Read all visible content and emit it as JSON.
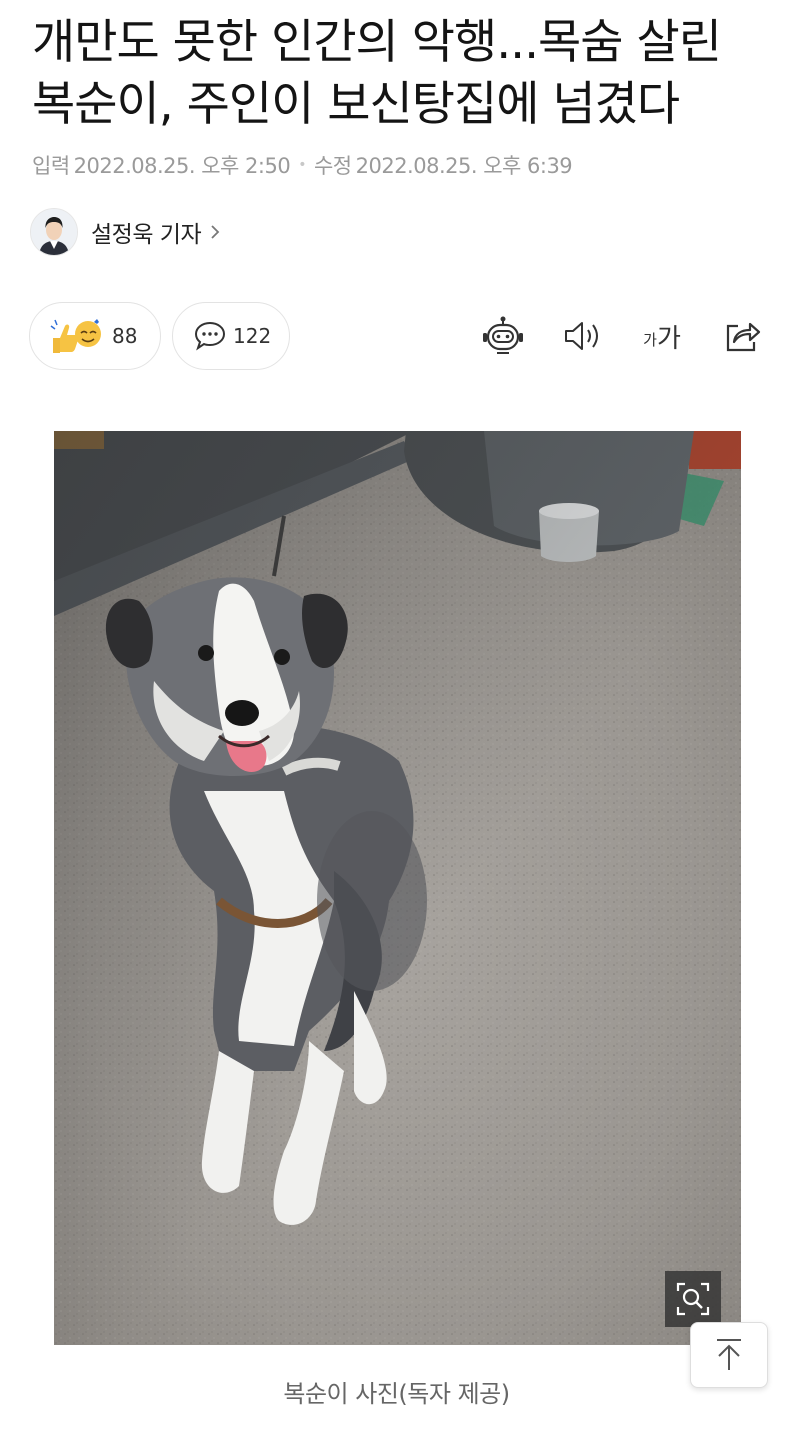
{
  "article": {
    "title": "개만도 못한 인간의 악행...목숨 살린 복순이, 주인이 보신탕집에 넘겼다",
    "published_label": "입력",
    "published": "2022.08.25. 오후 2:50",
    "modified_label": "수정",
    "modified": "2022.08.25. 오후 6:39",
    "reporter": "설정욱 기자"
  },
  "reactions": {
    "count": "88",
    "icons": [
      "thumbs-up-icon",
      "smiling-face-icon"
    ]
  },
  "comments": {
    "count": "122",
    "icon": "speech-bubble-icon"
  },
  "toolbar": {
    "summary_icon": "robot-icon",
    "tts_icon": "speaker-icon",
    "font_size": {
      "small": "가",
      "large": "가"
    },
    "share_icon": "share-icon"
  },
  "photo": {
    "caption": "복순이 사진(독자 제공)",
    "zoom_icon": "zoom-magnifier-icon"
  },
  "scroll_top_icon": "arrow-up-icon",
  "colors": {
    "meta_text": "#9a9a9a",
    "caption_text": "#666666",
    "emoji_yellow": "#f6c343"
  }
}
